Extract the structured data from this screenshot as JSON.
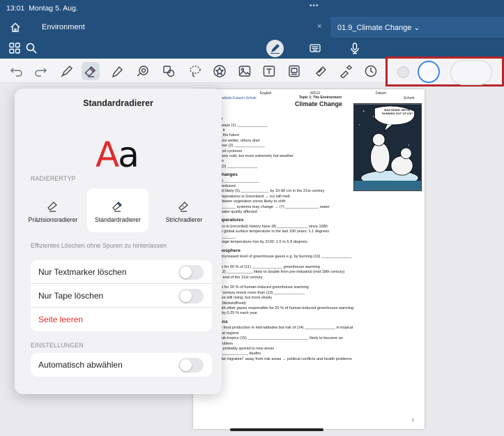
{
  "status": {
    "time": "13:01",
    "date": "Montag 5. Aug.",
    "dots": "•••"
  },
  "tabs": {
    "home_icon": "home-icon",
    "environment": "Environment",
    "close": "×",
    "document": "01.9_Climate Change ⌄"
  },
  "nav": {
    "grid_icon": "grid-icon",
    "search_icon": "search-icon",
    "pen_icon": "pencil-circle-icon",
    "keyboard_icon": "keyboard-icon",
    "mic_icon": "microphone-icon"
  },
  "toolbar": {
    "tools": [
      "undo-icon",
      "redo-icon",
      "pen-icon",
      "eraser-icon",
      "highlighter-icon",
      "shapes-icon",
      "elements-icon",
      "lasso-icon",
      "star-icon",
      "image-icon",
      "text-icon",
      "scan-icon",
      "tape-icon",
      "laser-pointer-icon",
      "clock-icon"
    ]
  },
  "colors": {
    "accent": "#3d88e6",
    "header": "#234f7c",
    "red": "#e0302b",
    "highlight_box": "#b7252b"
  },
  "popover": {
    "title": "Standardradierer",
    "preview_text": "Aa",
    "eraser_type_label": "RADIERERTYP",
    "erasers": [
      {
        "label": "Präzisionsradierer"
      },
      {
        "label": "Standardradierer"
      },
      {
        "label": "Strichradierer"
      }
    ],
    "description": "Effizientes Löschen ohne Spuren zu hinterlassen",
    "rows": [
      {
        "label": "Nur Textmarker löschen"
      },
      {
        "label": "Nur Tape löschen"
      },
      {
        "label": "Seite leeren"
      }
    ],
    "settings_label": "EINSTELLUNGEN",
    "auto_deselect": "Automatisch abwählen"
  },
  "page": {
    "header_left": "English",
    "header_mid": "WG12",
    "header_right": "Datum:",
    "school": "Gallwitz-Esbach-Schule",
    "topic": "Topic 1: The Environment",
    "name_label": "Schork",
    "title": "Climate Change",
    "cartoon_caption": "BAD NEWS: WE'RE RUNNING OUT OF ICE!",
    "page_number": "1",
    "lines": [
      {
        "t": "mate change",
        "h": true
      },
      {
        "t": "climate has always (1) ______________",
        "h": false
      },
      {
        "t": "humans affect it",
        "h": false
      },
      {
        "t": "predictions for the future",
        "h": false
      },
      {
        "t": "o   some regions wetter, others drier",
        "h": false
      },
      {
        "t": "o   more summer (2) ______________",
        "h": false
      },
      {
        "t": "o   more tropical cyclones",
        "h": false
      },
      {
        "t": "o   less extremely cold, but more extremely hot weather",
        "h": false
      },
      {
        "t": "o   heavier rain",
        "h": false
      },
      {
        "t": "o   increased (3) ______________",
        "h": false
      },
      {
        "t": "ographical changes",
        "h": true
      },
      {
        "t": "glaciers are (4) ________________",
        "h": false
      },
      {
        "t": "arctic sea-ice reduced",
        "h": false
      },
      {
        "t": "global sea level likely (5) _____________ by 10-90 cm in the 21st century",
        "h": false
      },
      {
        "t": "increase of temperatures in Greenland → ice will melt",
        "h": false
      },
      {
        "t": "boundaries between vegetation zones likely to shift",
        "h": false
      },
      {
        "t": "(6) _______________ systems may change → (7) _______________, water",
        "h": false
      },
      {
        "t": "supplies and water quality affected",
        "h": false
      },
      {
        "t": "anges in temperatures",
        "h": true
      },
      {
        "t": "18 hottest years in (recorded) history have (8) ______________ since 1980",
        "h": false
      },
      {
        "t": "rise in average global surface temperature in the last 100 years: 1.1 degrees",
        "h": false
      },
      {
        "t": "(9) _______________",
        "h": false
      },
      {
        "t": "estimated average temperature rise by 2100: 1.5 to 5.9 degrees",
        "h": false
      },
      {
        "t": "anges in atmosphere",
        "h": true
      },
      {
        "t": "humans have increased level of greenhouse gases e.g. by burning (10) ______________",
        "h": false
      },
      {
        "t": "CO2",
        "h": false
      },
      {
        "t": "o   responsible for 60 % of (11) ______________ greenhouse warming",
        "h": false
      },
      {
        "t": "o   levels of (12) ____________ likely to double from pre-industrial (mid 18th century)",
        "h": false
      },
      {
        "t": "    levels by the end of the 21st century",
        "h": false
      },
      {
        "t": "methane",
        "h": false
      },
      {
        "t": "o   responsible for 20 % of human-induced greenhouse warming",
        "h": false
      },
      {
        "t": "o   in the 20th century levels more than (13) ______________",
        "h": false
      },
      {
        "t": "o   now they are still rising; but more slowly",
        "h": false
      },
      {
        "t": "nitrous oxide (Stickstoffoxid)",
        "h": false
      },
      {
        "t": "o   together with other gases responsible for 20 % of human-induced greenhouse warming",
        "h": false
      },
      {
        "t": "o   levels rise by 0.25 % each year",
        "h": false
      },
      {
        "t": "her predictions",
        "h": true
      },
      {
        "t": "possibly better food production in mid-latitudes but risk of (14) ______________ in tropical",
        "h": false
      },
      {
        "t": "and sub-tropical regions",
        "h": false
      },
      {
        "t": "especially in sub-tropics (15) ____________________________ likely to become an",
        "h": false
      },
      {
        "t": "even bigger problem",
        "h": false
      },
      {
        "t": "•  diseases will probably spread to new areas",
        "h": false
      },
      {
        "t": "•  more (16) ______________ deaths",
        "h": false
      },
      {
        "t": "•  \"environmental migration\" away from risk areas → political conflicts and health problems",
        "h": false
      }
    ]
  }
}
